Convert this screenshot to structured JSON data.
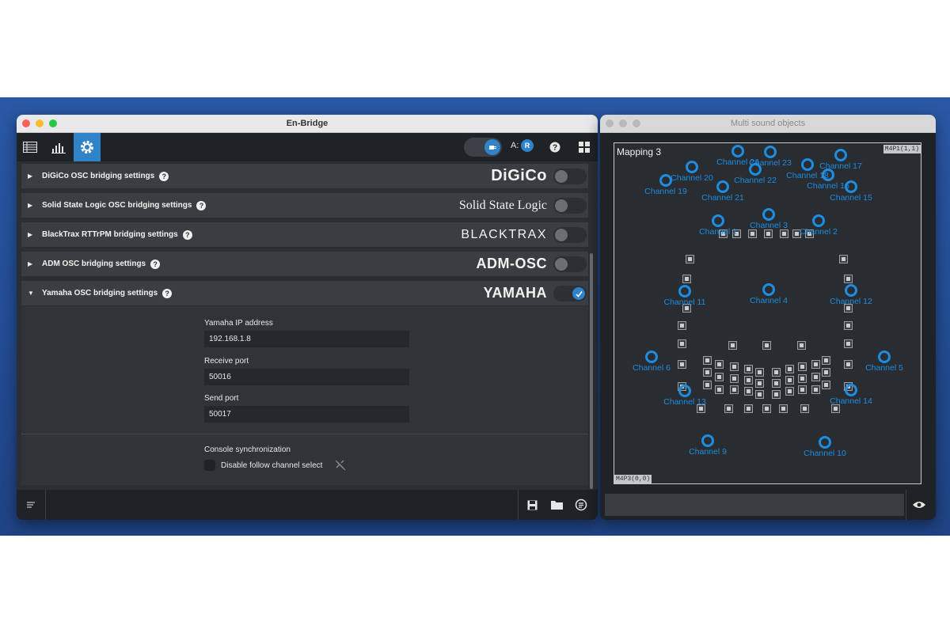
{
  "left_window": {
    "title": "En-Bridge",
    "toolbar": {
      "tabs": [
        {
          "icon": "table-icon"
        },
        {
          "icon": "levels-icon"
        },
        {
          "icon": "gear-icon",
          "active": true
        }
      ],
      "a_label": "A:",
      "a_badge": "R",
      "help_icon": "help-icon",
      "layout_icon": "grid-icon"
    },
    "sections": [
      {
        "title": "DiGiCo OSC bridging settings",
        "logo": "DiGiCo",
        "expanded": false,
        "enabled": false
      },
      {
        "title": "Solid State Logic OSC bridging settings",
        "logo": "Solid State Logic",
        "expanded": false,
        "enabled": false
      },
      {
        "title": "BlackTrax RTTrPM bridging settings",
        "logo": "BLACKTRAX",
        "expanded": false,
        "enabled": false
      },
      {
        "title": "ADM OSC bridging settings",
        "logo": "ADM-OSC",
        "expanded": false,
        "enabled": false
      },
      {
        "title": "Yamaha OSC bridging settings",
        "logo": "YAMAHA",
        "expanded": true,
        "enabled": true
      }
    ],
    "yamaha": {
      "ip_label": "Yamaha IP address",
      "ip_value": "192.168.1.8",
      "receive_label": "Receive port",
      "receive_value": "50016",
      "send_label": "Send port",
      "send_value": "50017",
      "sync_label": "Console synchronization",
      "disable_follow_label": "Disable follow channel select",
      "disable_follow_checked": false
    },
    "bottom": {
      "buttons": [
        "save-icon",
        "folder-icon",
        "reload-icon"
      ]
    }
  },
  "right_window": {
    "title": "Multi sound objects",
    "map_title": "Mapping 3",
    "corner_top_right": "M4P1(1,1)",
    "corner_bottom_left": "M4P3(0,0)",
    "channels": [
      {
        "label": "Channel 1"
      },
      {
        "label": "Channel 2"
      },
      {
        "label": "Channel 3"
      },
      {
        "label": "Channel 4"
      },
      {
        "label": "Channel 5"
      },
      {
        "label": "Channel 6"
      },
      {
        "label": "Channel 9"
      },
      {
        "label": "Channel 10"
      },
      {
        "label": "Channel 11"
      },
      {
        "label": "Channel 12"
      },
      {
        "label": "Channel 13"
      },
      {
        "label": "Channel 14"
      },
      {
        "label": "Channel 15"
      },
      {
        "label": "Channel 16"
      },
      {
        "label": "Channel 17"
      },
      {
        "label": "Channel 18"
      },
      {
        "label": "Channel 19"
      },
      {
        "label": "Channel 20"
      },
      {
        "label": "Channel 21"
      },
      {
        "label": "Channel 22"
      },
      {
        "label": "Channel 23"
      },
      {
        "label": "Channel 24"
      }
    ],
    "eye_icon": "eye-icon"
  },
  "colors": {
    "accent": "#2f83c8",
    "channel": "#1d8de0"
  }
}
